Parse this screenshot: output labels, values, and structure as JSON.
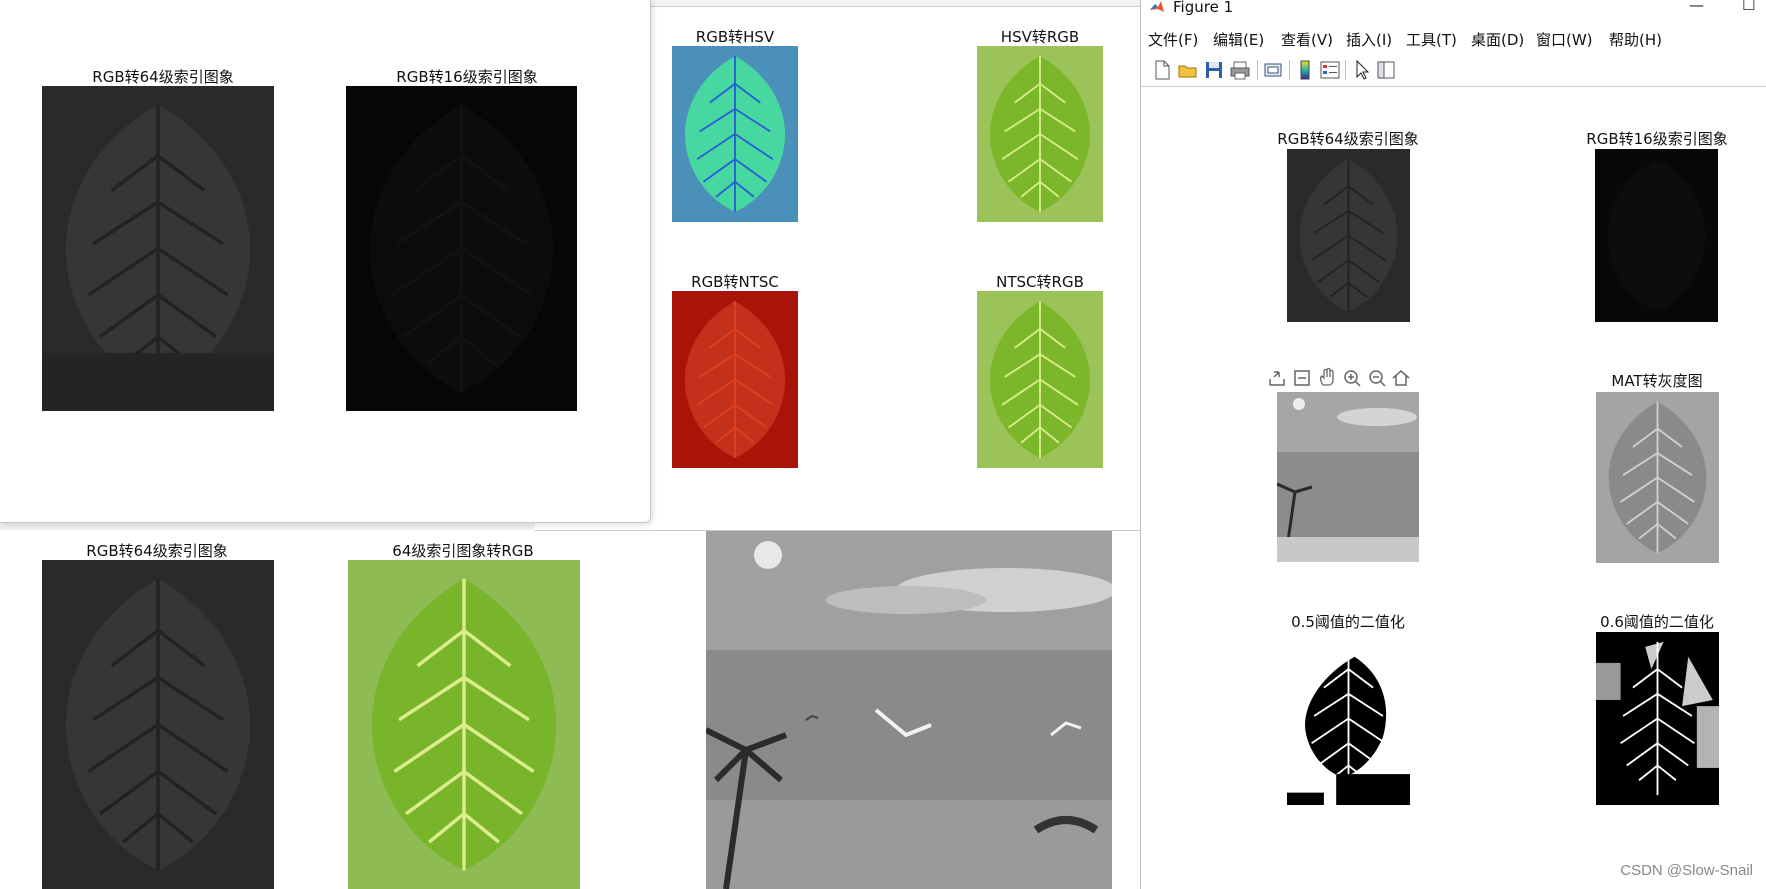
{
  "windows": {
    "left_top": {
      "titles": [
        "RGB转64级索引图象",
        "RGB转16级索引图象"
      ]
    },
    "middle_top": {
      "titles": [
        "RGB转HSV",
        "HSV转RGB",
        "RGB转NTSC",
        "NTSC转RGB"
      ]
    },
    "left_bottom": {
      "titles": [
        "RGB转64级索引图象",
        "64级索引图象转RGB"
      ]
    }
  },
  "figure1": {
    "title": "Figure 1",
    "controls": {
      "minimize": "—",
      "maximize": "☐"
    },
    "menu": [
      "文件(F)",
      "编辑(E)",
      "查看(V)",
      "插入(I)",
      "工具(T)",
      "桌面(D)",
      "窗口(W)",
      "帮助(H)"
    ],
    "toolbar_icons": [
      "new-file-icon",
      "open-folder-icon",
      "save-icon",
      "print-icon",
      "link-plot-icon",
      "colorbar-icon",
      "legend-icon",
      "pointer-icon",
      "property-editor-icon"
    ],
    "axes_toolbar_icons": [
      "export-icon",
      "brush-icon",
      "pan-icon",
      "zoom-in-icon",
      "zoom-out-icon",
      "home-icon"
    ],
    "subplot_titles": [
      "RGB转64级索引图象",
      "RGB转16级索引图象",
      "MAT转灰度图",
      "0.5阈值的二值化",
      "0.6阈值的二值化"
    ]
  },
  "watermark": "CSDN @Slow-Snail",
  "colors": {
    "leaf_green": "#7cb62a",
    "hsv_blue": "#3c7fc0",
    "ntsc_red": "#b31b0f",
    "bg_green": "#9cc25a"
  }
}
